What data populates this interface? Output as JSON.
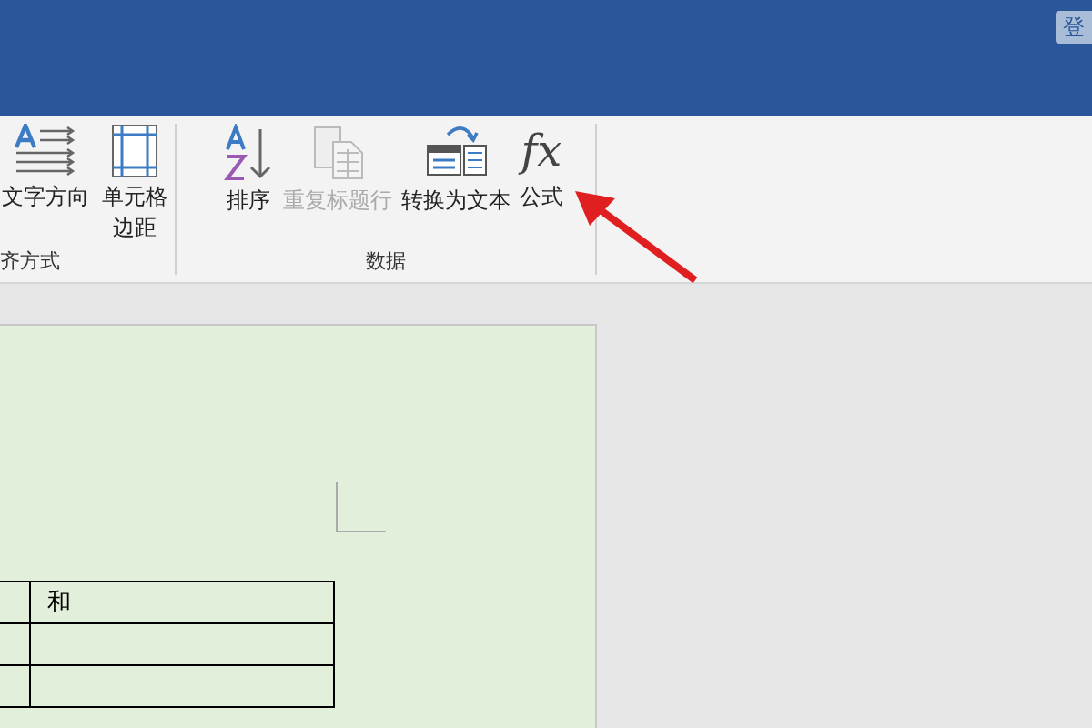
{
  "title_bar": {
    "button": "登"
  },
  "ribbon": {
    "groups": [
      {
        "label": "齐方式",
        "buttons": [
          {
            "kind": "text-direction",
            "label": "文字方向",
            "disabled": false
          },
          {
            "kind": "cell-margins",
            "label": "单元格边距",
            "disabled": false
          }
        ]
      },
      {
        "label": "数据",
        "buttons": [
          {
            "kind": "sort",
            "label": "排序",
            "disabled": false
          },
          {
            "kind": "repeat-header",
            "label": "重复标题行",
            "disabled": true
          },
          {
            "kind": "convert",
            "label": "转换为文本",
            "disabled": false
          },
          {
            "kind": "formula",
            "label": "公式",
            "glyph": "fx",
            "disabled": false
          }
        ]
      }
    ]
  },
  "table": {
    "rows": [
      [
        "",
        "和"
      ],
      [
        "",
        ""
      ],
      [
        "",
        ""
      ]
    ]
  }
}
